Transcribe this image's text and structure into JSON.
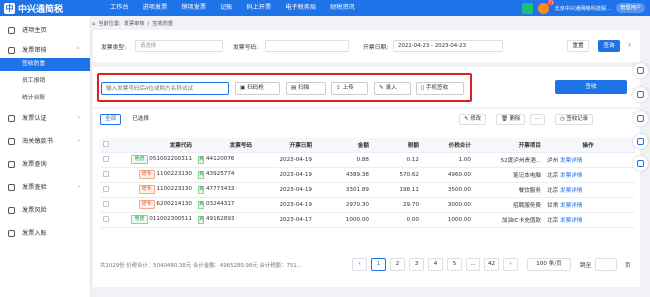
{
  "app": {
    "name": "中兴通简税",
    "logo_glyph": "中"
  },
  "topnav": [
    "工作台",
    "进项发票",
    "销项发票",
    "记账",
    "码上开票",
    "电子税务局",
    "财税资讯"
  ],
  "topbar": {
    "badge": "71",
    "company": "北京中兴通网络科技股...",
    "user": "管理用户"
  },
  "sidebar": [
    {
      "label": "进项主页",
      "icon": "home-icon",
      "arrow": ""
    },
    {
      "label": "发票审核",
      "icon": "invoice-check-icon",
      "arrow": "⌃",
      "active": true,
      "children": [
        {
          "label": "签收防重",
          "active": true
        },
        {
          "label": "员工报销"
        },
        {
          "label": "统计台账"
        }
      ]
    },
    {
      "label": "发票认证",
      "icon": "certify-icon",
      "arrow": "›"
    },
    {
      "label": "海关缴款书",
      "icon": "customs-icon",
      "arrow": "›"
    },
    {
      "label": "发票查询",
      "icon": "search-icon",
      "arrow": ""
    },
    {
      "label": "发票查验",
      "icon": "verify-icon",
      "arrow": "›"
    },
    {
      "label": "发票风险",
      "icon": "risk-icon",
      "arrow": ""
    },
    {
      "label": "发票入账",
      "icon": "ledger-icon",
      "arrow": ""
    }
  ],
  "breadcrumb": {
    "prefix": "当前位置:",
    "items": [
      "发票审核",
      "签收防重"
    ],
    "sep": "/"
  },
  "filter": {
    "type_label": "发票类型:",
    "type_placeholder": "请选择",
    "number_label": "发票号码:",
    "date_label": "开票日期:",
    "date_from": "2022-04-23",
    "date_sep": "-",
    "date_to": "2023-04-23",
    "reset": "重置",
    "search": "查询",
    "more": "›"
  },
  "toolbar": {
    "input_placeholder": "输入发票号码后4位或购方名称试试",
    "buttons": [
      "扫码枪",
      "扫描",
      "上传",
      "录入",
      "手机签收"
    ],
    "sign": "签收"
  },
  "tabs": [
    "全部",
    "已选择"
  ],
  "actions": [
    "修改",
    "删除",
    "签收记录"
  ],
  "columns": [
    "",
    "发票代码",
    "发票号码",
    "开票日期",
    "金额",
    "税额",
    "价税合计",
    "开票项目",
    "操作"
  ],
  "rows": [
    {
      "tag": "电普",
      "tag_color": "g",
      "code": "051002200311",
      "pill": "真",
      "number": "44120076",
      "date": "2023-04-19",
      "amount": "0.88",
      "tax": "0.12",
      "total": "1.00",
      "item": "52度泸州贵酒...",
      "op_prefix": "泸州",
      "op": "发票详情"
    },
    {
      "tag": "增专",
      "tag_color": "r",
      "code": "1100223130",
      "pill": "真",
      "number": "43925774",
      "date": "2023-04-19",
      "amount": "4389.38",
      "tax": "570.62",
      "total": "4960.00",
      "item": "笔记本电脑",
      "op_prefix": "北京",
      "op": "发票详情"
    },
    {
      "tag": "增专",
      "tag_color": "r",
      "code": "1100223130",
      "pill": "真",
      "number": "47773433",
      "date": "2023-04-19",
      "amount": "3301.89",
      "tax": "198.11",
      "total": "3500.00",
      "item": "餐饮服务",
      "op_prefix": "北京",
      "op": "发票详情"
    },
    {
      "tag": "增专",
      "tag_color": "r",
      "code": "6200214130",
      "pill": "真",
      "number": "03244317",
      "date": "2023-04-19",
      "amount": "2970.30",
      "tax": "29.70",
      "total": "3000.00",
      "item": "招聘服务费",
      "op_prefix": "甘肃",
      "op": "发票详情"
    },
    {
      "tag": "电普",
      "tag_color": "g",
      "code": "011002300511",
      "pill": "真",
      "number": "49162893",
      "date": "2023-04-17",
      "amount": "1000.00",
      "tax": "0.00",
      "total": "1000.00",
      "item": "加油IC卡充值款",
      "op_prefix": "北京",
      "op": "发票详情"
    }
  ],
  "footer": {
    "summary": "共1029份 价税合计：5040480.38元 合计金额：4965280.98元 合计税额：751...",
    "pages": [
      "‹",
      "1",
      "2",
      "3",
      "4",
      "5",
      "...",
      "42",
      "›"
    ],
    "page_size": "100 条/页",
    "goto": "跳至",
    "page_unit": "页"
  }
}
